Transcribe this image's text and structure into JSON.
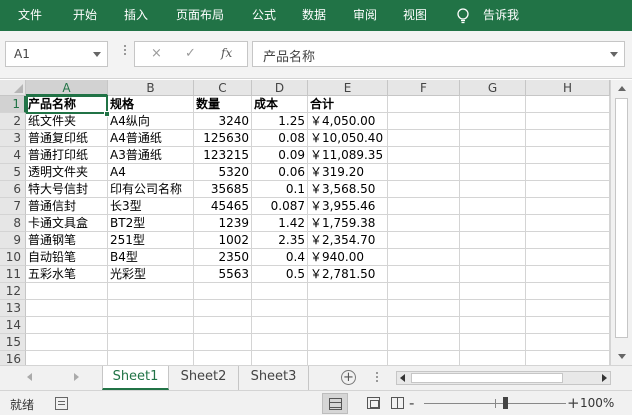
{
  "ribbon": {
    "tabs": [
      "文件",
      "开始",
      "插入",
      "页面布局",
      "公式",
      "数据",
      "审阅",
      "视图"
    ],
    "tell_me": "告诉我"
  },
  "formula_bar": {
    "name_box": "A1",
    "cancel_icon": "×",
    "enter_icon": "✓",
    "fx_label": "fx",
    "content": "产品名称"
  },
  "sheet": {
    "columns": [
      "A",
      "B",
      "C",
      "D",
      "E",
      "F",
      "G",
      "H"
    ],
    "rows": [
      "1",
      "2",
      "3",
      "4",
      "5",
      "6",
      "7",
      "8",
      "9",
      "10",
      "11",
      "12",
      "13",
      "14",
      "15",
      "16"
    ],
    "headers": [
      "产品名称",
      "规格",
      "数量",
      "成本",
      "合计"
    ],
    "data": [
      [
        "纸文件夹",
        "A4纵向",
        "3240",
        "1.25",
        "￥4,050.00"
      ],
      [
        "普通复印纸",
        "A4普通纸",
        "125630",
        "0.08",
        "￥10,050.40"
      ],
      [
        "普通打印纸",
        "A3普通纸",
        "123215",
        "0.09",
        "￥11,089.35"
      ],
      [
        "透明文件夹",
        "A4",
        "5320",
        "0.06",
        "￥319.20"
      ],
      [
        "特大号信封",
        "印有公司名称",
        "35685",
        "0.1",
        "￥3,568.50"
      ],
      [
        "普通信封",
        "长3型",
        "45465",
        "0.087",
        "￥3,955.46"
      ],
      [
        "卡通文具盒",
        "BT2型",
        "1239",
        "1.42",
        "￥1,759.38"
      ],
      [
        "普通钢笔",
        "251型",
        "1002",
        "2.35",
        "￥2,354.70"
      ],
      [
        "自动铅笔",
        "B4型",
        "2350",
        "0.4",
        "￥940.00"
      ],
      [
        "五彩水笔",
        "光彩型",
        "5563",
        "0.5",
        "￥2,781.50"
      ]
    ]
  },
  "sheet_tabs": [
    "Sheet1",
    "Sheet2",
    "Sheet3"
  ],
  "add_sheet": "+",
  "status": {
    "text": "就绪",
    "zoom_minus": "-",
    "zoom_plus": "+",
    "zoom": "100%"
  },
  "colors": {
    "accent": "#217346"
  }
}
